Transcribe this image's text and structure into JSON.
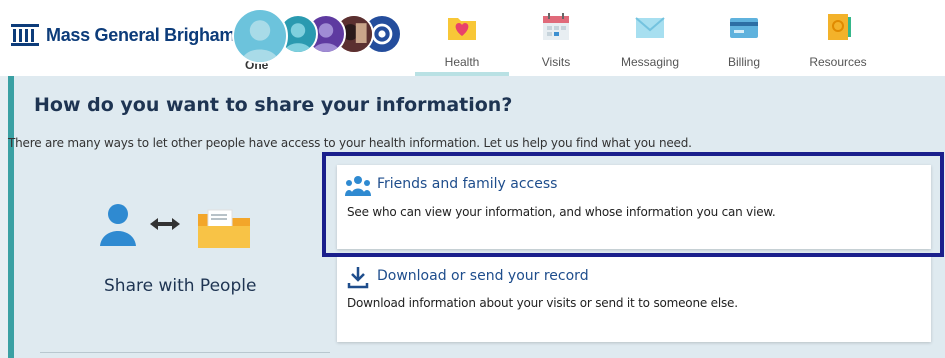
{
  "brand": {
    "name": "Mass General Brigham",
    "color": "#0d3c7a"
  },
  "profile": {
    "active_label": "One"
  },
  "nav": [
    {
      "label": "Health",
      "icon": "heart-folder-icon",
      "active": true
    },
    {
      "label": "Visits",
      "icon": "calendar-icon",
      "active": false
    },
    {
      "label": "Messaging",
      "icon": "envelope-icon",
      "active": false
    },
    {
      "label": "Billing",
      "icon": "credit-card-icon",
      "active": false
    },
    {
      "label": "Resources",
      "icon": "book-icon",
      "active": false
    }
  ],
  "page": {
    "title": "How do you want to share your information?",
    "intro": "There are many ways to let other people have access to your health information. Let us help you find what you need."
  },
  "share": {
    "label": "Share with People"
  },
  "options": [
    {
      "title": "Friends and family access",
      "description": "See who can view your information, and whose information you can view.",
      "icon": "people-group-icon",
      "highlighted": true
    },
    {
      "title": "Download or send your record",
      "description": "Download information about your visits or send it to someone else.",
      "icon": "download-icon",
      "highlighted": false
    }
  ],
  "colors": {
    "accent": "#3aa0a3",
    "highlight_border": "#1a1f8c",
    "link": "#1e4d8c",
    "background": "#dfeaf0"
  }
}
